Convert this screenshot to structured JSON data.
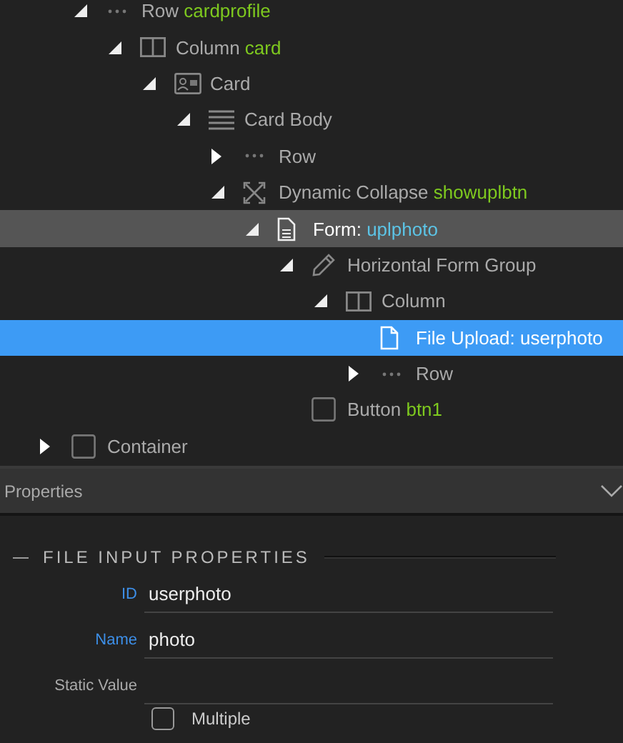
{
  "tree": [
    {
      "kind": "scrolled",
      "children": [
        {
          "kind": "row",
          "label": "Row",
          "name": "cardprofile",
          "expanded": true,
          "selected": false,
          "highlighted": false,
          "children": [
            {
              "kind": "column",
              "label": "Column",
              "name": "card",
              "expanded": true,
              "selected": false,
              "highlighted": false,
              "children": [
                {
                  "kind": "card",
                  "label": "Card",
                  "expanded": true,
                  "selected": false,
                  "highlighted": false,
                  "children": [
                    {
                      "kind": "card-body",
                      "label": "Card Body",
                      "expanded": true,
                      "selected": false,
                      "highlighted": false,
                      "children": [
                        {
                          "kind": "row",
                          "label": "Row",
                          "expanded": false,
                          "selected": false,
                          "highlighted": false
                        },
                        {
                          "kind": "collapse",
                          "label": "Dynamic Collapse",
                          "name": "showuplbtn",
                          "expanded": true,
                          "selected": false,
                          "highlighted": false,
                          "children": [
                            {
                              "kind": "form",
                              "label": "Form:",
                              "name": "uplphoto",
                              "expanded": true,
                              "selected": false,
                              "highlighted": true,
                              "children": [
                                {
                                  "kind": "form-group",
                                  "label": "Horizontal Form Group",
                                  "expanded": true,
                                  "selected": false,
                                  "highlighted": false,
                                  "children": [
                                    {
                                      "kind": "column",
                                      "label": "Column",
                                      "expanded": true,
                                      "selected": false,
                                      "highlighted": false,
                                      "children": [
                                        {
                                          "kind": "file",
                                          "label": "File Upload: userphoto",
                                          "selected": true,
                                          "highlighted": false
                                        },
                                        {
                                          "kind": "row",
                                          "label": "Row",
                                          "expanded": false,
                                          "selected": false,
                                          "highlighted": false
                                        }
                                      ]
                                    }
                                  ]
                                },
                                {
                                  "kind": "button",
                                  "label": "Button",
                                  "name": "btn1",
                                  "selected": false,
                                  "highlighted": false
                                }
                              ]
                            }
                          ]
                        }
                      ]
                    }
                  ]
                }
              ]
            }
          ]
        }
      ]
    },
    {
      "kind": "container",
      "label": "Container",
      "expanded": false,
      "selected": false,
      "highlighted": false
    }
  ],
  "properties": {
    "title": "Properties",
    "expanded": true,
    "section": "FILE INPUT PROPERTIES",
    "fields": [
      {
        "label": "ID",
        "value": "userphoto",
        "set": true
      },
      {
        "label": "Name",
        "value": "photo",
        "set": true
      },
      {
        "label": "Static Value",
        "set": false
      }
    ],
    "checkboxes": [
      {
        "label": "Multiple",
        "checked": false
      }
    ]
  }
}
